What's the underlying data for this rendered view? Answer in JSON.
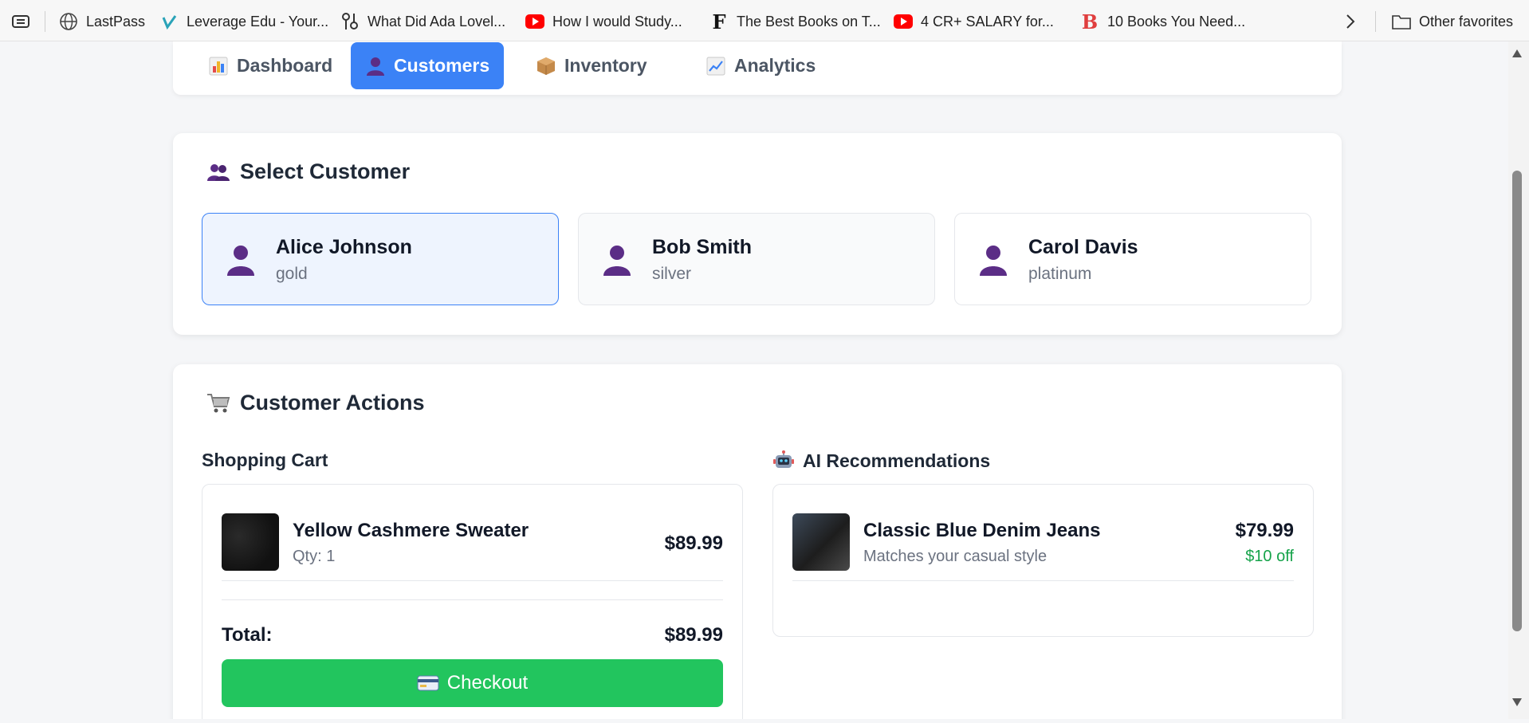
{
  "bookmarks": [
    {
      "label": "LastPass",
      "icon": "globe-icon"
    },
    {
      "label": "Leverage Edu - Your...",
      "icon": "leverage-edu-icon"
    },
    {
      "label": "What Did Ada Lovel...",
      "icon": "ada-icon"
    },
    {
      "label": "How I would Study...",
      "icon": "youtube-icon"
    },
    {
      "label": "The Best Books on T...",
      "icon": "f-icon"
    },
    {
      "label": "4 CR+ SALARY for...",
      "icon": "youtube-icon"
    },
    {
      "label": "10 Books You Need...",
      "icon": "b-icon"
    },
    {
      "label": "Other favorites",
      "icon": "folder-icon"
    }
  ],
  "nav": {
    "tabs": [
      {
        "label": "Dashboard",
        "icon": "bar-chart-icon",
        "active": false
      },
      {
        "label": "Customers",
        "icon": "person-icon",
        "active": true
      },
      {
        "label": "Inventory",
        "icon": "package-icon",
        "active": false
      },
      {
        "label": "Analytics",
        "icon": "trend-chart-icon",
        "active": false
      }
    ]
  },
  "select_customer": {
    "title": "Select Customer",
    "icon": "people-icon",
    "customers": [
      {
        "name": "Alice Johnson",
        "tier": "gold",
        "selected": true
      },
      {
        "name": "Bob Smith",
        "tier": "silver",
        "selected": false
      },
      {
        "name": "Carol Davis",
        "tier": "platinum",
        "selected": false
      }
    ]
  },
  "customer_actions": {
    "title": "Customer Actions",
    "icon": "cart-icon",
    "cart": {
      "title": "Shopping Cart",
      "items": [
        {
          "name": "Yellow Cashmere Sweater",
          "qty": "Qty: 1",
          "price": "$89.99"
        }
      ],
      "total_label": "Total:",
      "total_value": "$89.99",
      "checkout_label": "Checkout"
    },
    "recommendations": {
      "title": "AI Recommendations",
      "icon": "robot-icon",
      "items": [
        {
          "name": "Classic Blue Denim Jeans",
          "reason": "Matches your casual style",
          "price": "$79.99",
          "discount": "$10 off"
        }
      ]
    }
  },
  "colors": {
    "accent": "#3b82f6",
    "checkout": "#22c55e",
    "discount": "#16a34a",
    "avatar": "#5b2d86"
  }
}
